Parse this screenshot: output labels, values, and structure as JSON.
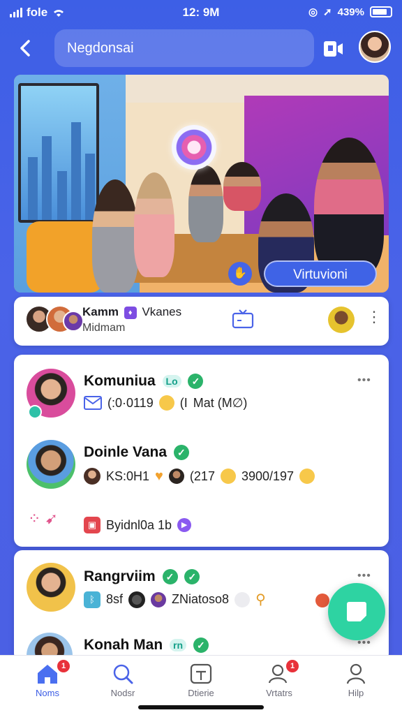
{
  "status": {
    "carrier": "fole",
    "time": "12: 9M",
    "battery": "439%"
  },
  "header": {
    "back_icon": "chevron-left-icon",
    "title": "Negdonsai",
    "pip_icon": "picture-in-picture-icon"
  },
  "hero": {
    "button_label": "Virtuvioni"
  },
  "live_strip": {
    "name": "Kamm",
    "sub": "Vkanes",
    "second_line": "Midmam"
  },
  "feed": [
    {
      "name": "Komuniua",
      "tag": "Lo",
      "line1_parts": [
        "(:0·0119",
        "(I",
        "Mat (M∅)"
      ],
      "more": "•••"
    },
    {
      "name": "Doinle Vana",
      "line1_parts": [
        "KS:0H1",
        "(217",
        "3900/197"
      ],
      "line2": "Byidnl0a 1b"
    },
    {
      "name": "Rangrviim",
      "line1_parts": [
        "8sf",
        "ZNiatoso8"
      ],
      "more": "•••"
    },
    {
      "name": "Konah Man",
      "tag": "rn",
      "more": "•••"
    }
  ],
  "tabs": [
    {
      "label": "Noms",
      "badge": "1",
      "icon": "home-icon"
    },
    {
      "label": "Nodsr",
      "icon": "search-icon"
    },
    {
      "label": "Dtierie",
      "icon": "tv-icon"
    },
    {
      "label": "Vrtatrs",
      "badge": "1",
      "icon": "users-icon"
    },
    {
      "label": "Hilp",
      "icon": "profile-icon"
    }
  ],
  "colors": {
    "background": "#4a63e8",
    "accent": "#3f63e6",
    "fab": "#2ed3a2",
    "verified": "#2bb36a",
    "badge": "#e8313a"
  }
}
